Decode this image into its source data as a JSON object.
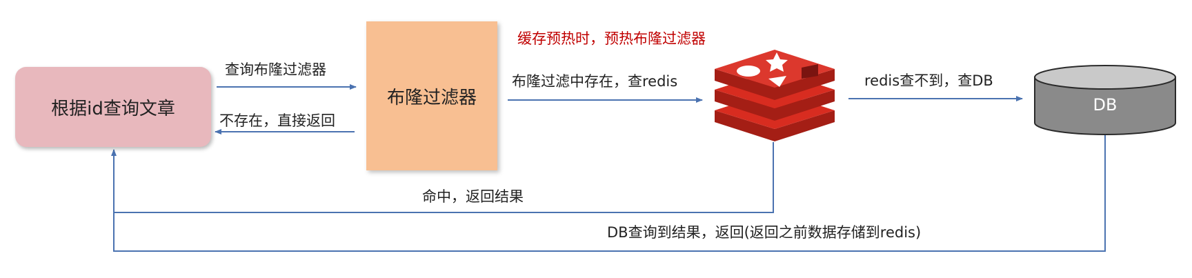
{
  "nodes": {
    "article_query": "根据id查询文章",
    "bloom_filter": "布隆过滤器",
    "db": "DB"
  },
  "edges": {
    "query_bloom": "查询布隆过滤器",
    "not_exist_return": "不存在，直接返回",
    "exists_check_redis": "布隆过滤中存在，查redis",
    "redis_miss_query_db": "redis查不到，查DB",
    "hit_return": "命中，返回结果",
    "db_return": "DB查询到结果，返回(返回之前数据存储到redis)"
  },
  "annotations": {
    "cache_warmup": "缓存预热时，预热布隆过滤器"
  },
  "icons": {
    "redis": "redis-icon",
    "db": "database-cylinder-icon"
  },
  "colors": {
    "arrow": "#4a72b0",
    "article_fill": "#e8b8bd",
    "bloom_fill": "#f8bf92",
    "redis_red": "#d82c20",
    "db_gray": "#8a8a8a",
    "annotation_red": "#c00000"
  }
}
